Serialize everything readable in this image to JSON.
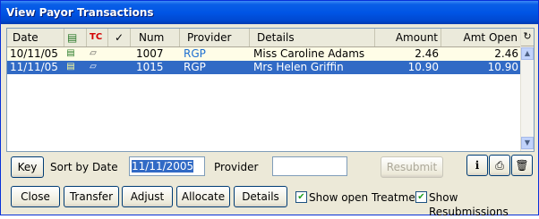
{
  "window": {
    "title": "View Payor Transactions"
  },
  "grid": {
    "columns": [
      "Date",
      "Num",
      "Provider",
      "Details",
      "Amount",
      "Amt Open"
    ],
    "header_icons": {
      "tc": "TC",
      "check": "✓"
    },
    "rows": [
      {
        "date": "10/11/05",
        "num": "1007",
        "provider": "RGP",
        "details": "Miss Caroline Adams",
        "amount": "2.46",
        "amt_open": "2.46",
        "selected": false
      },
      {
        "date": "11/11/05",
        "num": "1015",
        "provider": "RGP",
        "details": "Mrs Helen Griffin",
        "amount": "10.90",
        "amt_open": "10.90",
        "selected": true
      }
    ]
  },
  "controls": {
    "key_label": "Key",
    "sort_label": "Sort by Date",
    "date_value": "11/11/2005",
    "provider_label": "Provider",
    "provider_value": "",
    "resubmit_label": "Resubmit"
  },
  "buttons": {
    "close": "Close",
    "transfer": "Transfer",
    "adjust": "Adjust",
    "allocate": "Allocate",
    "details": "Details"
  },
  "checkboxes": {
    "show_open_treatment": {
      "label": "Show open Treatment",
      "checked": true
    },
    "show_resubmissions": {
      "label": "Show Resubmissions",
      "checked": true
    }
  },
  "icons": [
    "info-icon",
    "print-icon",
    "trash-icon",
    "document-icon",
    "folder-icon",
    "refresh-icon"
  ]
}
